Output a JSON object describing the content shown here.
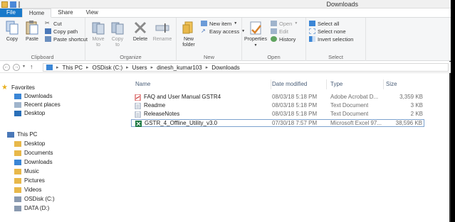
{
  "window": {
    "title": "Downloads"
  },
  "tabs": [
    {
      "label": "File"
    },
    {
      "label": "Home"
    },
    {
      "label": "Share"
    },
    {
      "label": "View"
    }
  ],
  "ribbon": {
    "clipboard": {
      "copy": "Copy",
      "paste": "Paste",
      "cut": "Cut",
      "copy_path": "Copy path",
      "paste_shortcut": "Paste shortcut",
      "group": "Clipboard"
    },
    "organize": {
      "move_to": "Move",
      "move_to2": "to",
      "copy_to": "Copy",
      "copy_to2": "to",
      "delete": "Delete",
      "rename": "Rename",
      "group": "Organize"
    },
    "new": {
      "new_folder": "New",
      "new_folder2": "folder",
      "new_item": "New item",
      "easy_access": "Easy access",
      "group": "New"
    },
    "open": {
      "properties": "Properties",
      "open": "Open",
      "edit": "Edit",
      "history": "History",
      "group": "Open"
    },
    "select": {
      "select_all": "Select all",
      "select_none": "Select none",
      "invert": "Invert selection",
      "group": "Select"
    }
  },
  "address": {
    "crumbs": [
      "This PC",
      "OSDisk (C:)",
      "Users",
      "dinesh_kumar103",
      "Downloads"
    ]
  },
  "nav": {
    "favorites": "Favorites",
    "favorites_items": [
      "Downloads",
      "Recent places",
      "Desktop"
    ],
    "this_pc": "This PC",
    "pc_items": [
      "Desktop",
      "Documents",
      "Downloads",
      "Music",
      "Pictures",
      "Videos",
      "OSDisk (C:)",
      "DATA (D:)"
    ]
  },
  "columns": {
    "name": "Name",
    "date": "Date modified",
    "type": "Type",
    "size": "Size"
  },
  "files": [
    {
      "name": "FAQ and User Manual GSTR4",
      "date": "08/03/18 5:18 PM",
      "type": "Adobe Acrobat D...",
      "size": "3,359 KB",
      "icon": "pdf-icon"
    },
    {
      "name": "Readme",
      "date": "08/03/18 5:18 PM",
      "type": "Text Document",
      "size": "3 KB",
      "icon": "text-file-icon"
    },
    {
      "name": "ReleaseNotes",
      "date": "08/03/18 5:18 PM",
      "type": "Text Document",
      "size": "2 KB",
      "icon": "text-file-icon"
    },
    {
      "name": "GSTR_4_Offline_Utility_v3.0",
      "date": "07/30/18 7:57 PM",
      "type": "Microsoft Excel 97...",
      "size": "38,596 KB",
      "icon": "excel-icon"
    }
  ],
  "colors": {
    "file_tab": "#1979ca",
    "selection_border": "#7da2ce"
  }
}
